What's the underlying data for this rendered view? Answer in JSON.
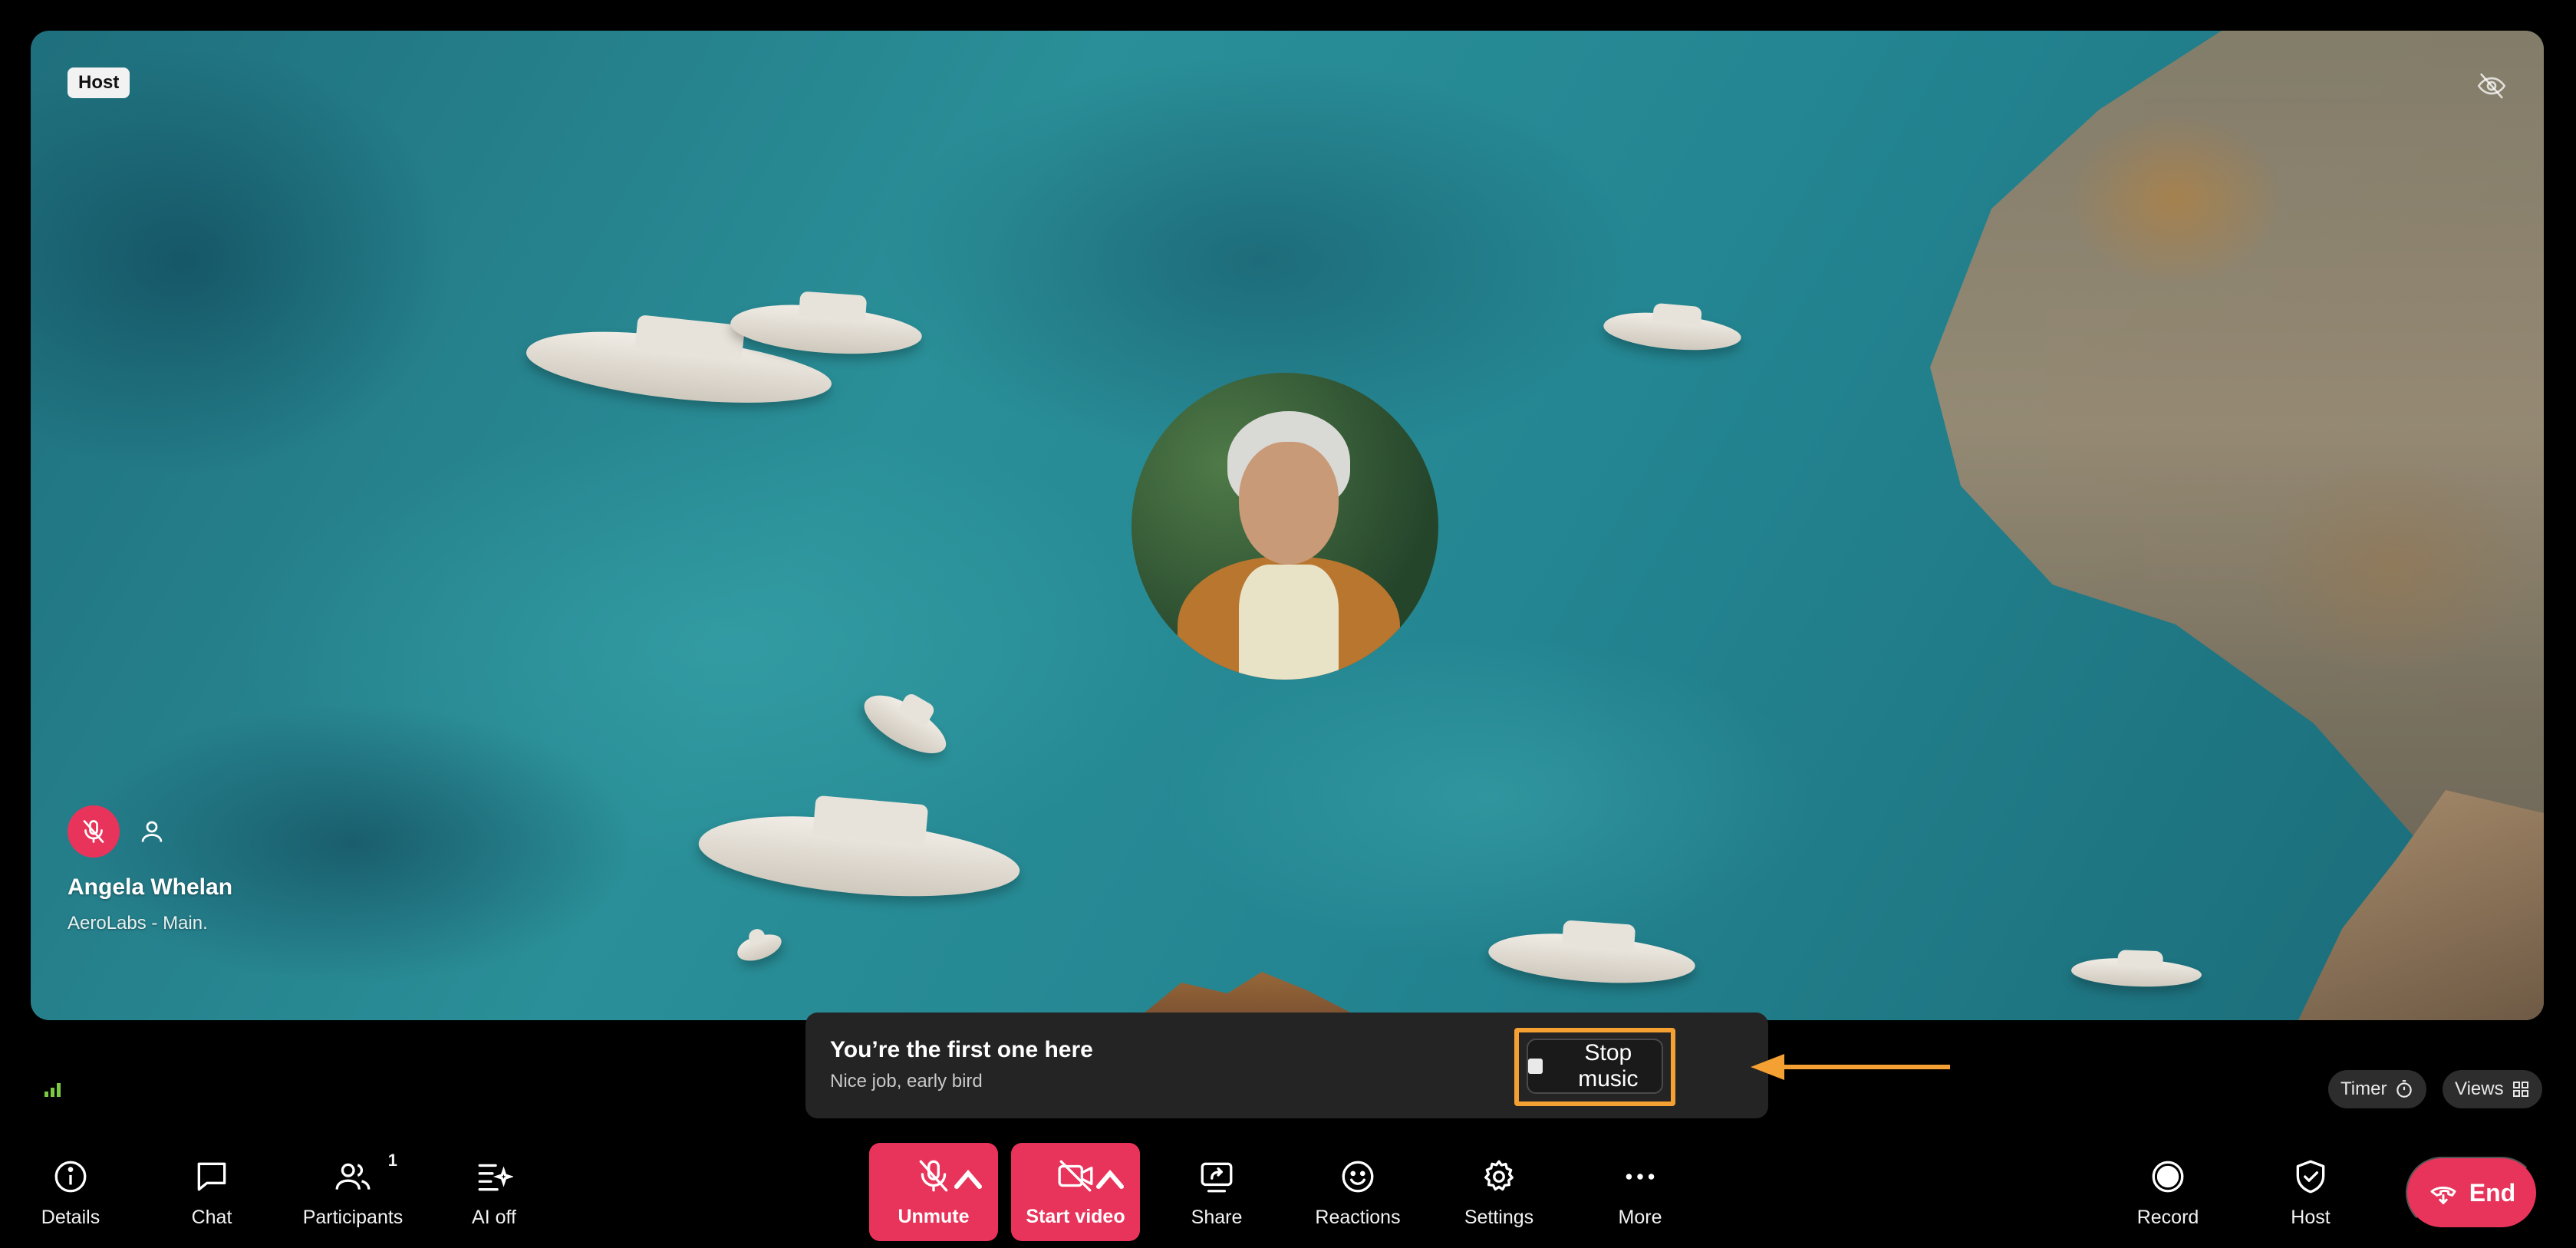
{
  "stage": {
    "host_badge": "Host",
    "participant": {
      "name": "Angela Whelan",
      "location": "AeroLabs - Main."
    }
  },
  "toast": {
    "title": "You’re the first one here",
    "subtitle": "Nice job, early bird",
    "stop_music_label": "Stop music"
  },
  "pills": {
    "timer_label": "Timer",
    "views_label": "Views"
  },
  "toolbar": {
    "details": "Details",
    "chat": "Chat",
    "participants": "Participants",
    "participants_count": "1",
    "ai": "AI off",
    "unmute": "Unmute",
    "start_video": "Start video",
    "share": "Share",
    "reactions": "Reactions",
    "settings": "Settings",
    "more": "More",
    "record": "Record",
    "host": "Host",
    "end": "End"
  },
  "colors": {
    "danger": "#e8345a",
    "highlight": "#f5a032",
    "toast_bg": "#242424",
    "signal": "#7ac943"
  },
  "icons": [
    "eye-off-icon",
    "mic-off-icon",
    "person-icon",
    "signal-icon",
    "stop-icon",
    "arrow-left-icon",
    "stopwatch-icon",
    "grid-icon",
    "info-icon",
    "chat-icon",
    "participants-icon",
    "ai-sparkle-icon",
    "video-off-icon",
    "share-screen-icon",
    "smiley-icon",
    "gear-icon",
    "ellipsis-icon",
    "record-icon",
    "shield-check-icon",
    "phone-hangup-icon"
  ]
}
